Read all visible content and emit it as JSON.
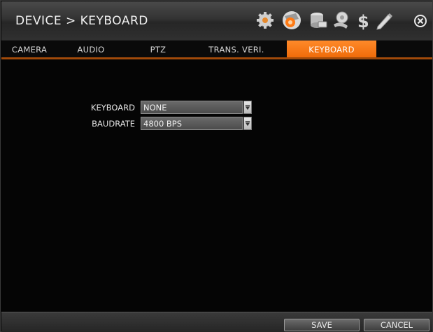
{
  "header": {
    "title": "DEVICE > KEYBOARD",
    "icons": [
      "gear-icon",
      "camera-icon",
      "storage-icon",
      "network-icon",
      "dollar-icon",
      "pen-icon"
    ],
    "close_icon": "close-icon"
  },
  "tabs": [
    {
      "label": "CAMERA",
      "active": false
    },
    {
      "label": "AUDIO",
      "active": false
    },
    {
      "label": "PTZ",
      "active": false
    },
    {
      "label": "TRANS. VERI.",
      "active": false
    },
    {
      "label": "KEYBOARD",
      "active": true
    }
  ],
  "form": {
    "keyboard": {
      "label": "KEYBOARD",
      "value": "NONE"
    },
    "baudrate": {
      "label": "BAUDRATE",
      "value": "4800 BPS"
    }
  },
  "footer": {
    "save_label": "SAVE",
    "cancel_label": "CANCEL"
  },
  "colors": {
    "accent": "#f07010",
    "background": "#050505"
  }
}
